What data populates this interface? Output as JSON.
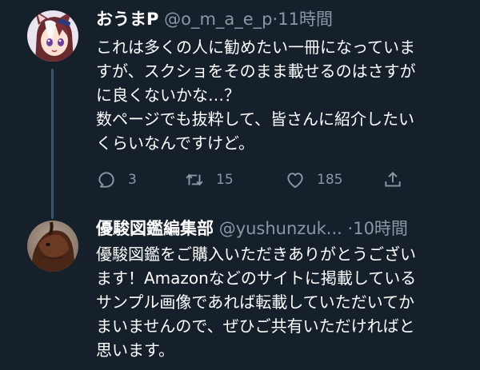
{
  "colors": {
    "background": "#15202b",
    "secondary_text": "#8899a6",
    "thread_line": "#3d5466"
  },
  "tweet1": {
    "display_name": "おうまP",
    "handle": "@o_m_a_e_p",
    "separator": "·",
    "time": "11時間",
    "lines": [
      "これは多くの人に勧めたい一冊になっていま",
      "すが、スクショをそのまま載せるのはさすが",
      "に良くないかな…？",
      "数ページでも抜粋して、皆さんに紹介したい",
      "くらいなんですけど。"
    ],
    "actions": {
      "reply_icon": "reply-icon",
      "reply_count": "3",
      "retweet_icon": "retweet-icon",
      "retweet_count": "15",
      "like_icon": "heart-icon",
      "like_count": "185",
      "share_icon": "share-icon"
    }
  },
  "tweet2": {
    "display_name": "優駿図鑑編集部",
    "handle": "@yushunzuk...",
    "separator": "·",
    "time": "10時間",
    "lines": [
      "優駿図鑑をご購入いただきありがとうござい",
      "ます！Amazonなどのサイトに掲載している",
      "サンプル画像であれば転載していただいてか",
      "まいませんので、ぜひご共有いただければと",
      "思います。"
    ]
  }
}
